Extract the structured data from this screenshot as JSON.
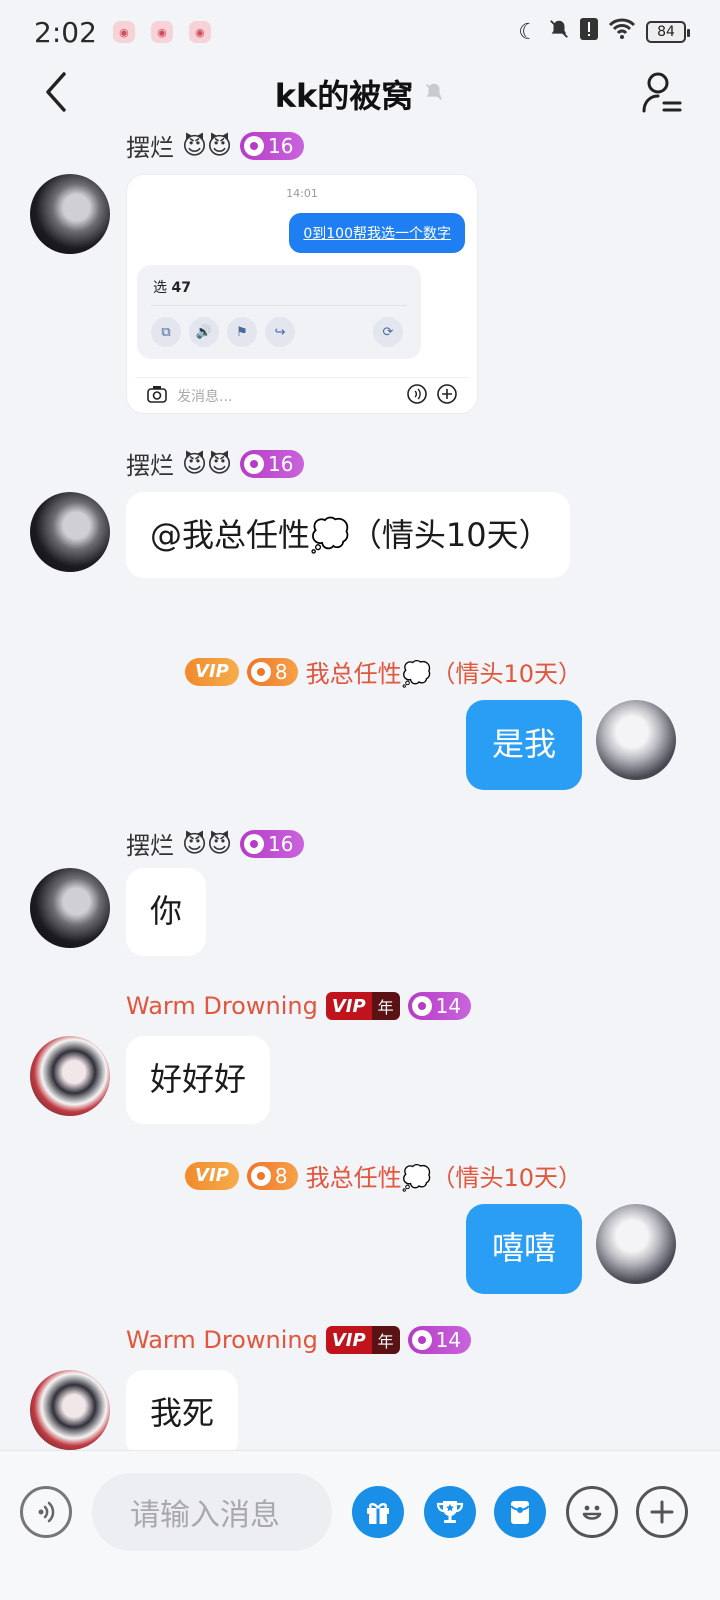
{
  "status_bar": {
    "time": "2:02",
    "battery": "84"
  },
  "nav": {
    "title": "kk的被窝"
  },
  "messages": [
    {
      "sender": "摆烂",
      "emojis": "😈😈",
      "level": "16",
      "type": "image",
      "image": {
        "time": "14:01",
        "question": "0到100帮我选一个数字",
        "answer_prefix": "选",
        "answer_value": "47",
        "input_placeholder": "发消息..."
      }
    },
    {
      "sender": "摆烂",
      "emojis": "😈😈",
      "level": "16",
      "text": "@我总任性💭（情头10天）"
    },
    {
      "sender": "我总任性💭（情头10天）",
      "vip": "VIP",
      "level": "8",
      "text": "是我",
      "is_me": true
    },
    {
      "sender": "摆烂",
      "emojis": "😈😈",
      "level": "16",
      "text": "你"
    },
    {
      "sender": "Warm Drowning",
      "vip": "VIP",
      "vip_year": "年",
      "level": "14",
      "text": "好好好"
    },
    {
      "sender": "我总任性💭（情头10天）",
      "vip": "VIP",
      "level": "8",
      "text": "嘻嘻",
      "is_me": true
    },
    {
      "sender": "Warm Drowning",
      "vip": "VIP",
      "vip_year": "年",
      "level": "14",
      "text": "我死"
    }
  ],
  "composer": {
    "placeholder": "请输入消息"
  },
  "colors": {
    "my_bubble": "#2a9df4",
    "level_purple": "#b53cc7",
    "level_orange": "#f07628",
    "name_red": "#e2563c",
    "accent_blue": "#1a8fe8"
  }
}
